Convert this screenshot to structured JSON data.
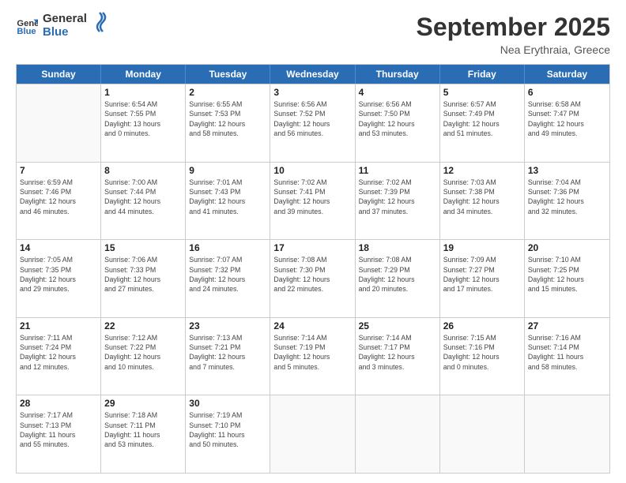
{
  "header": {
    "logo_general": "General",
    "logo_blue": "Blue",
    "month": "September 2025",
    "location": "Nea Erythraia, Greece"
  },
  "weekdays": [
    "Sunday",
    "Monday",
    "Tuesday",
    "Wednesday",
    "Thursday",
    "Friday",
    "Saturday"
  ],
  "rows": [
    [
      {
        "day": "",
        "info": ""
      },
      {
        "day": "1",
        "info": "Sunrise: 6:54 AM\nSunset: 7:55 PM\nDaylight: 13 hours\nand 0 minutes."
      },
      {
        "day": "2",
        "info": "Sunrise: 6:55 AM\nSunset: 7:53 PM\nDaylight: 12 hours\nand 58 minutes."
      },
      {
        "day": "3",
        "info": "Sunrise: 6:56 AM\nSunset: 7:52 PM\nDaylight: 12 hours\nand 56 minutes."
      },
      {
        "day": "4",
        "info": "Sunrise: 6:56 AM\nSunset: 7:50 PM\nDaylight: 12 hours\nand 53 minutes."
      },
      {
        "day": "5",
        "info": "Sunrise: 6:57 AM\nSunset: 7:49 PM\nDaylight: 12 hours\nand 51 minutes."
      },
      {
        "day": "6",
        "info": "Sunrise: 6:58 AM\nSunset: 7:47 PM\nDaylight: 12 hours\nand 49 minutes."
      }
    ],
    [
      {
        "day": "7",
        "info": "Sunrise: 6:59 AM\nSunset: 7:46 PM\nDaylight: 12 hours\nand 46 minutes."
      },
      {
        "day": "8",
        "info": "Sunrise: 7:00 AM\nSunset: 7:44 PM\nDaylight: 12 hours\nand 44 minutes."
      },
      {
        "day": "9",
        "info": "Sunrise: 7:01 AM\nSunset: 7:43 PM\nDaylight: 12 hours\nand 41 minutes."
      },
      {
        "day": "10",
        "info": "Sunrise: 7:02 AM\nSunset: 7:41 PM\nDaylight: 12 hours\nand 39 minutes."
      },
      {
        "day": "11",
        "info": "Sunrise: 7:02 AM\nSunset: 7:39 PM\nDaylight: 12 hours\nand 37 minutes."
      },
      {
        "day": "12",
        "info": "Sunrise: 7:03 AM\nSunset: 7:38 PM\nDaylight: 12 hours\nand 34 minutes."
      },
      {
        "day": "13",
        "info": "Sunrise: 7:04 AM\nSunset: 7:36 PM\nDaylight: 12 hours\nand 32 minutes."
      }
    ],
    [
      {
        "day": "14",
        "info": "Sunrise: 7:05 AM\nSunset: 7:35 PM\nDaylight: 12 hours\nand 29 minutes."
      },
      {
        "day": "15",
        "info": "Sunrise: 7:06 AM\nSunset: 7:33 PM\nDaylight: 12 hours\nand 27 minutes."
      },
      {
        "day": "16",
        "info": "Sunrise: 7:07 AM\nSunset: 7:32 PM\nDaylight: 12 hours\nand 24 minutes."
      },
      {
        "day": "17",
        "info": "Sunrise: 7:08 AM\nSunset: 7:30 PM\nDaylight: 12 hours\nand 22 minutes."
      },
      {
        "day": "18",
        "info": "Sunrise: 7:08 AM\nSunset: 7:29 PM\nDaylight: 12 hours\nand 20 minutes."
      },
      {
        "day": "19",
        "info": "Sunrise: 7:09 AM\nSunset: 7:27 PM\nDaylight: 12 hours\nand 17 minutes."
      },
      {
        "day": "20",
        "info": "Sunrise: 7:10 AM\nSunset: 7:25 PM\nDaylight: 12 hours\nand 15 minutes."
      }
    ],
    [
      {
        "day": "21",
        "info": "Sunrise: 7:11 AM\nSunset: 7:24 PM\nDaylight: 12 hours\nand 12 minutes."
      },
      {
        "day": "22",
        "info": "Sunrise: 7:12 AM\nSunset: 7:22 PM\nDaylight: 12 hours\nand 10 minutes."
      },
      {
        "day": "23",
        "info": "Sunrise: 7:13 AM\nSunset: 7:21 PM\nDaylight: 12 hours\nand 7 minutes."
      },
      {
        "day": "24",
        "info": "Sunrise: 7:14 AM\nSunset: 7:19 PM\nDaylight: 12 hours\nand 5 minutes."
      },
      {
        "day": "25",
        "info": "Sunrise: 7:14 AM\nSunset: 7:17 PM\nDaylight: 12 hours\nand 3 minutes."
      },
      {
        "day": "26",
        "info": "Sunrise: 7:15 AM\nSunset: 7:16 PM\nDaylight: 12 hours\nand 0 minutes."
      },
      {
        "day": "27",
        "info": "Sunrise: 7:16 AM\nSunset: 7:14 PM\nDaylight: 11 hours\nand 58 minutes."
      }
    ],
    [
      {
        "day": "28",
        "info": "Sunrise: 7:17 AM\nSunset: 7:13 PM\nDaylight: 11 hours\nand 55 minutes."
      },
      {
        "day": "29",
        "info": "Sunrise: 7:18 AM\nSunset: 7:11 PM\nDaylight: 11 hours\nand 53 minutes."
      },
      {
        "day": "30",
        "info": "Sunrise: 7:19 AM\nSunset: 7:10 PM\nDaylight: 11 hours\nand 50 minutes."
      },
      {
        "day": "",
        "info": ""
      },
      {
        "day": "",
        "info": ""
      },
      {
        "day": "",
        "info": ""
      },
      {
        "day": "",
        "info": ""
      }
    ]
  ]
}
